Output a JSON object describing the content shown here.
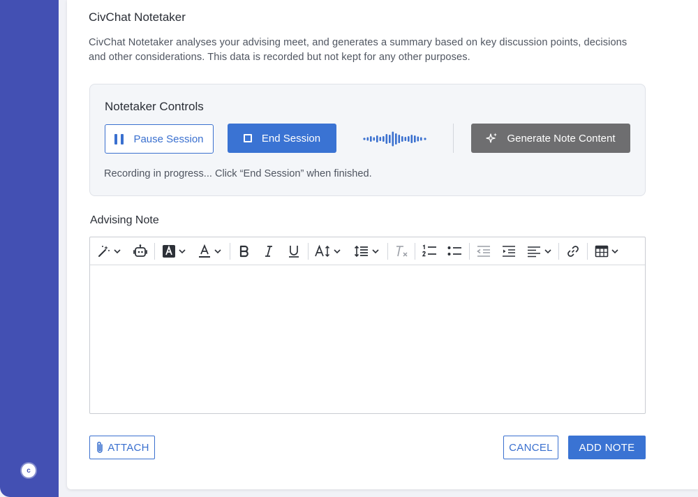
{
  "notetaker": {
    "title": "CivChat Notetaker",
    "description": "CivChat Notetaker analyses your advising meet, and generates a summary based on key discussion points, decisions and other considerations. This data is recorded but not kept for any other purposes.",
    "controls": {
      "title": "Notetaker Controls",
      "pause_label": "Pause Session",
      "end_label": "End Session",
      "generate_label": "Generate Note Content",
      "status": "Recording in progress... Click “End Session” when finished."
    }
  },
  "advising_note": {
    "label": "Advising Note",
    "content": "",
    "toolbar": [
      "magic-wand-icon",
      "ai-assistant-icon",
      "highlight-color-icon",
      "text-color-icon",
      "bold-icon",
      "italic-icon",
      "underline-icon",
      "font-size-icon",
      "line-height-icon",
      "clear-format-icon",
      "numbered-list-icon",
      "bullet-list-icon",
      "outdent-icon",
      "indent-icon",
      "align-icon",
      "link-icon",
      "table-icon"
    ]
  },
  "actions": {
    "attach_label": "ATTACH",
    "cancel_label": "CANCEL",
    "add_label": "ADD NOTE"
  },
  "colors": {
    "sidebar": "#4350b3",
    "primary": "#3a73d3",
    "generate_disabled": "#6e6e70"
  }
}
